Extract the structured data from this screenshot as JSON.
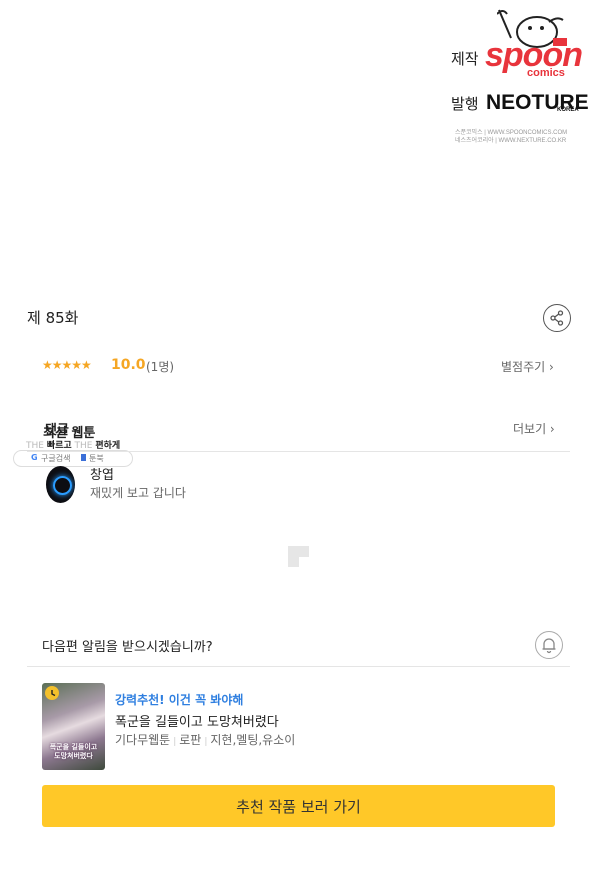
{
  "credits": {
    "produced_label": "제작",
    "publisher_label": "발행",
    "spoon_logo_text": "spoon",
    "spoon_sub_text": "comics",
    "neoture_logo_text": "NEOTURE",
    "neoture_sub_text": "KOREA",
    "line1_left": "스푼코믹스",
    "line1_right": "WWW.SPOONCOMICS.COM",
    "line2_left": "네스츠어코리아",
    "line2_right": "WWW.NEXTURE.CO.KR"
  },
  "episode": {
    "title": "제 85화",
    "share_icon": "share-icon"
  },
  "rating": {
    "stars": "★★★★★",
    "score": "10.0",
    "count": "(1명)",
    "rate_link": "별점주기 ›"
  },
  "comments": {
    "header_a": "댓글",
    "header_b": "최신 웹툰",
    "more_link": "더보기 ›",
    "ghost_line": [
      "THE",
      "빠르고",
      "THE",
      "편하게"
    ],
    "search_pill_left": "구글검색",
    "search_pill_right": "툰북",
    "items": [
      {
        "name": "창엽",
        "text": "재밌게 보고 갑니다"
      }
    ]
  },
  "notify": {
    "question": "다음편 알림을 받으시겠습니까?",
    "icon": "bell-icon"
  },
  "recommend": {
    "tag": "강력추천! 이건 꼭 봐야해",
    "title": "폭군을 길들이고 도망쳐버렸다",
    "meta": [
      "기다무웹툰",
      "로판",
      "지현,멜팅,유소이"
    ],
    "thumb_caption": "폭군을 길들이고 도망쳐버렸다",
    "cta": "추천 작품 보러 가기"
  },
  "colors": {
    "accent_yellow": "#ffc828",
    "star_orange": "#f5a623",
    "link_blue": "#2f7fe0",
    "brand_red": "#e8343c"
  }
}
